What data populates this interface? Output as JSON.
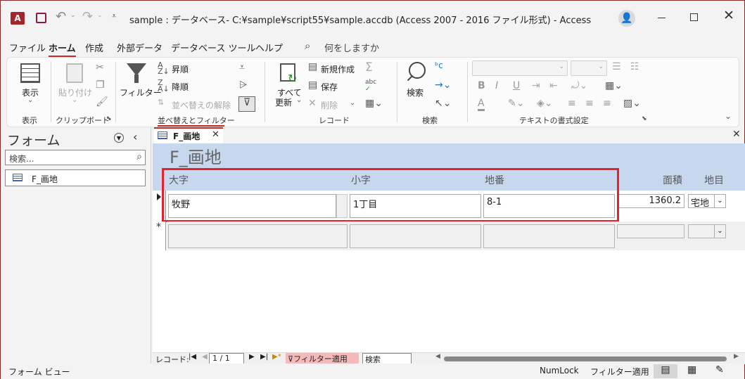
{
  "titlebar": {
    "title": "sample : データベース- C:¥sample¥script55¥sample.accdb (Access 2007 - 2016 ファイル形式)  -  Access"
  },
  "menu": {
    "items": [
      "ファイル",
      "ホーム",
      "作成",
      "外部データ",
      "データベース ツール",
      "ヘルプ"
    ],
    "active_index": 1,
    "search": "何をしますか"
  },
  "ribbon": {
    "view": {
      "label": "表示",
      "group": "表示"
    },
    "clipboard": {
      "paste": "貼り付け",
      "group": "クリップボード"
    },
    "sort": {
      "filter": "フィルター",
      "asc": "昇順",
      "desc": "降順",
      "clear": "並べ替えの解除",
      "group": "並べ替えとフィルター"
    },
    "records": {
      "refresh": "すべて\n更新",
      "refresh_line1": "すべて",
      "refresh_line2": "更新",
      "new": "新規作成",
      "save": "保存",
      "delete": "削除",
      "group": "レコード"
    },
    "find": {
      "find": "検索",
      "group": "検索"
    },
    "text": {
      "bold": "B",
      "italic": "I",
      "underline": "U",
      "group": "テキストの書式設定"
    }
  },
  "nav": {
    "title": "フォーム",
    "search_placeholder": "検索...",
    "items": [
      "F_画地"
    ]
  },
  "doc": {
    "tab": "F_画地",
    "form_title": "F_画地",
    "columns": {
      "ooaza": "大字",
      "koaza": "小字",
      "chiban": "地番",
      "menseki": "面積",
      "chimoku": "地目"
    },
    "record": {
      "ooaza": "牧野",
      "koaza": "1丁目",
      "chiban": "8-1",
      "menseki": "1360.2",
      "chimoku": "宅地"
    }
  },
  "record_nav": {
    "label": "レコード:",
    "position": "1 / 1",
    "filter": "フィルター適用",
    "search": "検索"
  },
  "status": {
    "view": "フォーム ビュー",
    "numlock": "NumLock",
    "filter": "フィルター適用"
  },
  "colors": {
    "accent": "#c42b2b",
    "highlight_box": "#e8202a",
    "header_bg": "#c7d7ee"
  }
}
